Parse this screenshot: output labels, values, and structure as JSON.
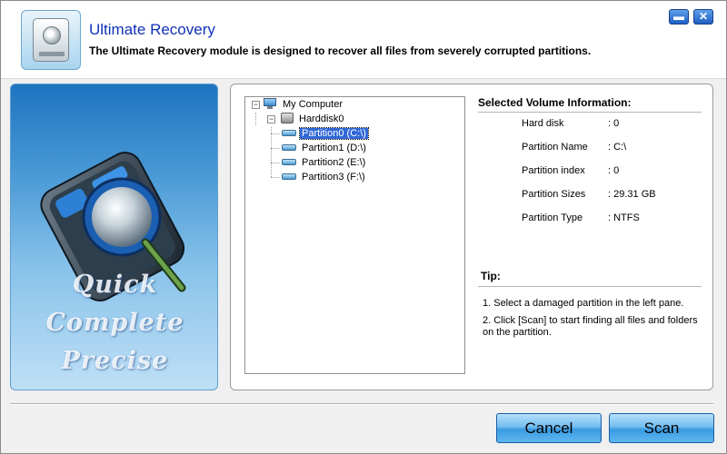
{
  "header": {
    "title": "Ultimate Recovery",
    "description": "The Ultimate Recovery module is designed to recover all files from severely corrupted partitions."
  },
  "window_controls": {
    "minimize": "▬",
    "close": "✕"
  },
  "left_panel": {
    "slogan": [
      "Quick",
      "Complete",
      "Precise"
    ]
  },
  "tree": {
    "root": "My Computer",
    "disk": "Harddisk0",
    "partitions": [
      "Partition0 (C:\\)",
      "Partition1 (D:\\)",
      "Partition2 (E:\\)",
      "Partition3 (F:\\)"
    ],
    "selected_index": 0
  },
  "volume_info": {
    "title": "Selected Volume Information:",
    "rows": [
      {
        "label": "Hard disk",
        "value": ": 0"
      },
      {
        "label": "Partition Name",
        "value": ": C:\\"
      },
      {
        "label": "Partition index",
        "value": ": 0"
      },
      {
        "label": "Partition Sizes",
        "value": ": 29.31 GB"
      },
      {
        "label": "Partition Type",
        "value": ": NTFS"
      }
    ]
  },
  "tip": {
    "title": "Tip:",
    "items": [
      "1. Select a damaged partition in the left pane.",
      "2. Click [Scan] to start finding all files and folders on the partition."
    ]
  },
  "buttons": {
    "cancel": "Cancel",
    "scan": "Scan"
  },
  "colors": {
    "title": "#1030b8",
    "selection": "#3168d6",
    "button": "#5eb6f0"
  }
}
